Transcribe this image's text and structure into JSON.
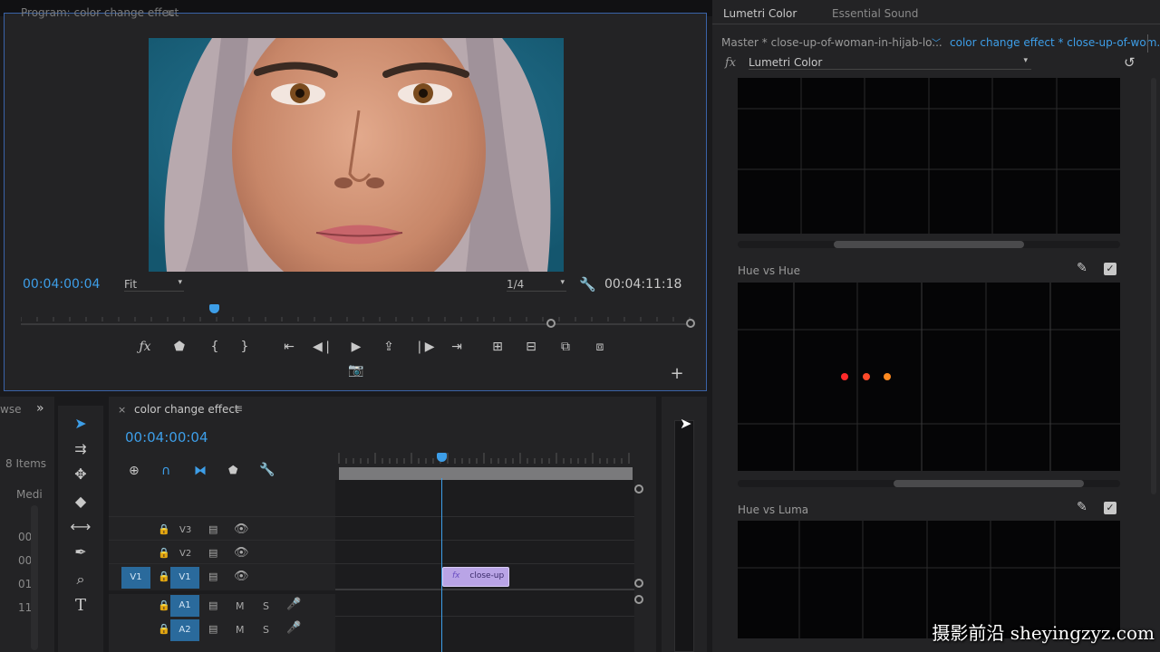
{
  "program": {
    "title": "Program: color change effect",
    "menu_icon": "≡",
    "timecode_current": "00:04:00:04",
    "fit": "Fit",
    "resolution": "1/4",
    "timecode_duration": "00:04:11:18"
  },
  "project": {
    "tab_partial": "wse",
    "items": "8 Items",
    "column": "Medi",
    "rows": [
      "00",
      "00",
      "01",
      "11"
    ]
  },
  "timeline": {
    "close": "×",
    "title": "color change effect",
    "menu_icon": "≡",
    "timecode": "00:04:00:04",
    "tracks": [
      {
        "name": "V3",
        "kind": "video"
      },
      {
        "name": "V2",
        "kind": "video"
      },
      {
        "name": "V1",
        "kind": "video",
        "source": "V1"
      },
      {
        "name": "A1",
        "kind": "audio"
      },
      {
        "name": "A2",
        "kind": "audio"
      }
    ],
    "mute_label": "M",
    "solo_label": "S",
    "clip_fx": "fx",
    "clip_name": "close-up",
    "clip_color": "#b9a4e6"
  },
  "lumetri": {
    "tab_active": "Lumetri Color",
    "tab_other": "Essential Sound",
    "master_label": "Master * close-up-of-woman-in-hijab-lo...",
    "sequence_label": "color change effect * close-up-of-wom...",
    "fx_label": "fx",
    "effect_name": "Lumetri Color",
    "hue_vs_hue": "Hue vs Hue",
    "hue_vs_luma": "Hue vs Luma"
  },
  "colors": {
    "accent_blue": "#3d9ee8",
    "panel_bg": "#232325",
    "focus_border": "#3a63a8"
  },
  "watermark": "摄影前沿 sheyingzyz.com"
}
